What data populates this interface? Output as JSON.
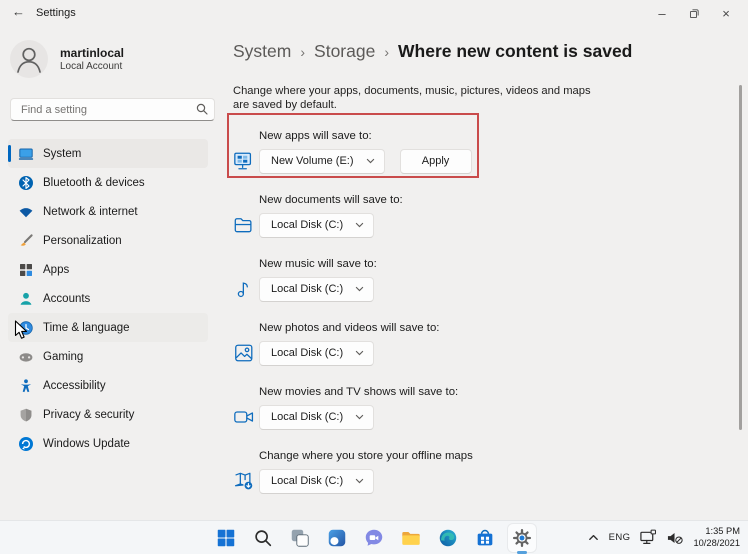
{
  "titlebar": {
    "title": "Settings"
  },
  "glyphs": {
    "back_arrow": "←",
    "breadcrumb_separator": "›",
    "minimize": "–",
    "close": "×"
  },
  "account": {
    "name": "martinlocal",
    "type": "Local Account"
  },
  "search": {
    "placeholder": "Find a setting"
  },
  "sidebar": {
    "items": [
      {
        "label": "System"
      },
      {
        "label": "Bluetooth & devices"
      },
      {
        "label": "Network & internet"
      },
      {
        "label": "Personalization"
      },
      {
        "label": "Apps"
      },
      {
        "label": "Accounts"
      },
      {
        "label": "Time & language"
      },
      {
        "label": "Gaming"
      },
      {
        "label": "Accessibility"
      },
      {
        "label": "Privacy & security"
      },
      {
        "label": "Windows Update"
      }
    ]
  },
  "breadcrumb": {
    "items": [
      {
        "label": "System"
      },
      {
        "label": "Storage"
      },
      {
        "label": "Where new content is saved"
      }
    ]
  },
  "page": {
    "description_line1": "Change where your apps, documents, music, pictures, videos and maps",
    "description_line2": "are saved by default.",
    "sections": [
      {
        "label": "New apps will save to:",
        "value": "New Volume (E:)",
        "apply_label": "Apply"
      },
      {
        "label": "New documents will save to:",
        "value": "Local Disk (C:)"
      },
      {
        "label": "New music will save to:",
        "value": "Local Disk (C:)"
      },
      {
        "label": "New photos and videos will save to:",
        "value": "Local Disk (C:)"
      },
      {
        "label": "New movies and TV shows will save to:",
        "value": "Local Disk (C:)"
      },
      {
        "label": "Change where you store your offline maps",
        "value": "Local Disk (C:)"
      }
    ]
  },
  "annotation": {
    "highlight_color": "#c94b4b"
  },
  "taskbar": {
    "tray": {
      "language": "ENG",
      "time": "1:35 PM",
      "date": "10/28/2021"
    }
  },
  "colors": {
    "accent": "#0067c0",
    "content_icon_blue": "#0f6cbd",
    "selected_item_bg": "#eae8e6"
  }
}
